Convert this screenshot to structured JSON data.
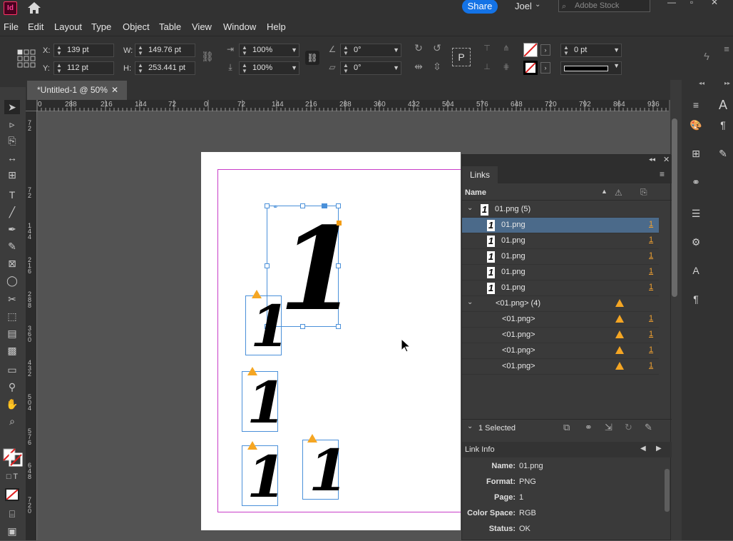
{
  "app": {
    "icon_label": "Id",
    "share_label": "Share",
    "user_name": "Joel",
    "stock_placeholder": "Adobe Stock"
  },
  "menu": [
    "File",
    "Edit",
    "Layout",
    "Type",
    "Object",
    "Table",
    "View",
    "Window",
    "Help"
  ],
  "control": {
    "x_label": "X:",
    "x_value": "139 pt",
    "y_label": "Y:",
    "y_value": "112 pt",
    "w_label": "W:",
    "w_value": "149.76 pt",
    "h_label": "H:",
    "h_value": "253.441 pt",
    "scale_x": "100%",
    "scale_y": "100%",
    "rotate": "0°",
    "shear": "0°",
    "stroke_weight": "0 pt"
  },
  "document_tab": {
    "title": "*Untitled-1 @ 50%",
    "close": "✕"
  },
  "ruler": {
    "h_ticks": [
      "0",
      "288",
      "216",
      "144",
      "72",
      "0",
      "72",
      "144",
      "216",
      "288",
      "360",
      "432",
      "504",
      "576",
      "648",
      "720",
      "792",
      "864",
      "936"
    ],
    "v_ticks": [
      "72",
      "72",
      "144",
      "216",
      "288",
      "360",
      "432",
      "504",
      "576",
      "648",
      "720"
    ]
  },
  "links_panel": {
    "tab": "Links",
    "name_header": "Name",
    "rows": [
      {
        "name": "01.png (5)",
        "page": "",
        "warn": false,
        "group": true,
        "selected": false,
        "thumb": true
      },
      {
        "name": "01.png",
        "page": "1",
        "warn": false,
        "group": false,
        "selected": true,
        "thumb": true
      },
      {
        "name": "01.png",
        "page": "1",
        "warn": false,
        "group": false,
        "selected": false,
        "thumb": true
      },
      {
        "name": "01.png",
        "page": "1",
        "warn": false,
        "group": false,
        "selected": false,
        "thumb": true
      },
      {
        "name": "01.png",
        "page": "1",
        "warn": false,
        "group": false,
        "selected": false,
        "thumb": true
      },
      {
        "name": "01.png",
        "page": "1",
        "warn": false,
        "group": false,
        "selected": false,
        "thumb": true
      },
      {
        "name": "<01.png> (4)",
        "page": "",
        "warn": true,
        "group": true,
        "selected": false,
        "thumb": false
      },
      {
        "name": "<01.png>",
        "page": "1",
        "warn": true,
        "group": false,
        "selected": false,
        "thumb": false
      },
      {
        "name": "<01.png>",
        "page": "1",
        "warn": true,
        "group": false,
        "selected": false,
        "thumb": false
      },
      {
        "name": "<01.png>",
        "page": "1",
        "warn": true,
        "group": false,
        "selected": false,
        "thumb": false
      },
      {
        "name": "<01.png>",
        "page": "1",
        "warn": true,
        "group": false,
        "selected": false,
        "thumb": false
      }
    ],
    "selected_count": "1 Selected",
    "link_info_title": "Link Info",
    "info": [
      {
        "key": "Name:",
        "value": "01.png"
      },
      {
        "key": "Format:",
        "value": "PNG"
      },
      {
        "key": "Page:",
        "value": "1"
      },
      {
        "key": "Color Space:",
        "value": "RGB"
      },
      {
        "key": "Status:",
        "value": "OK"
      }
    ]
  },
  "canvas_glyph": "1"
}
